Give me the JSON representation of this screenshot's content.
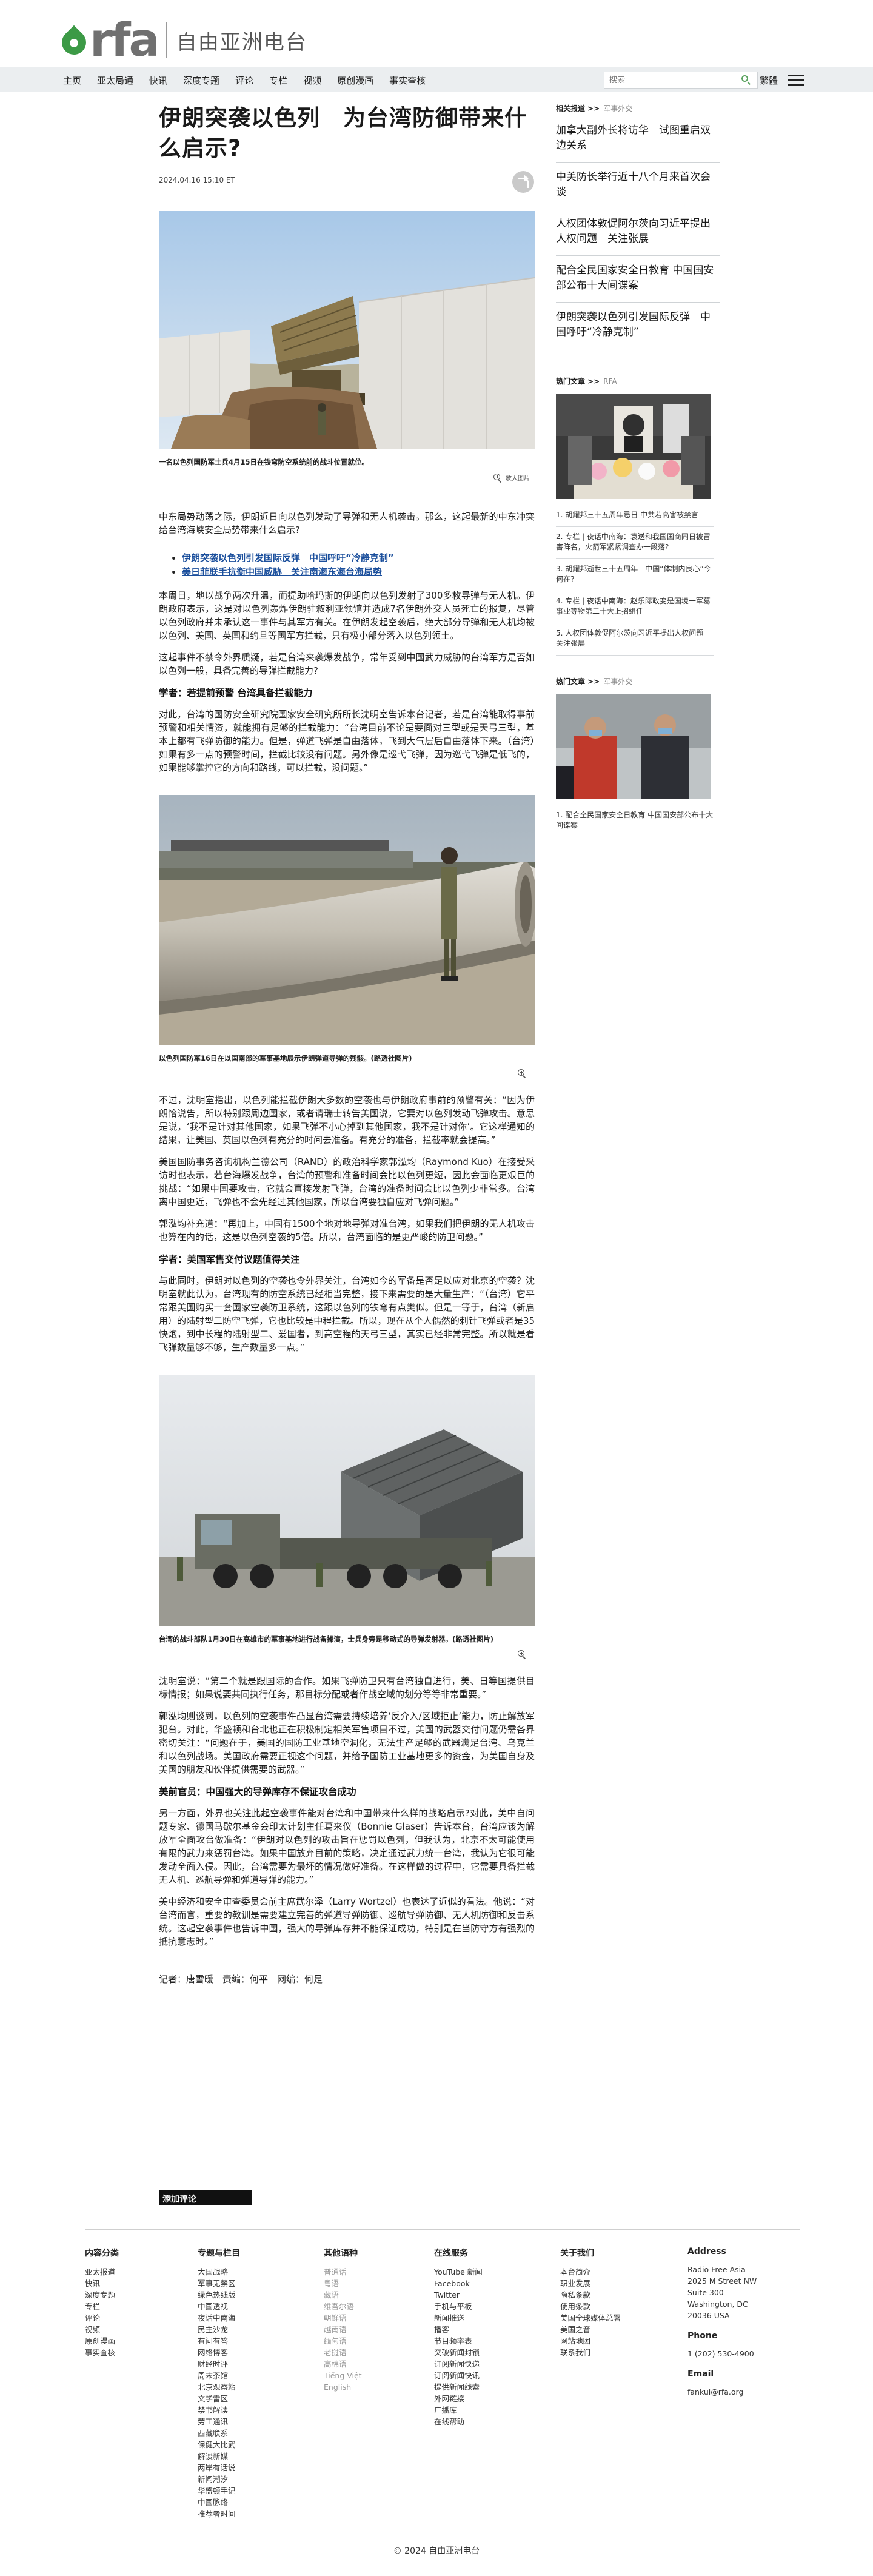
{
  "header": {
    "logo_text": "rfa",
    "logo_cn": "自由亚洲电台"
  },
  "nav": {
    "items": [
      "主页",
      "亚太局通",
      "快讯",
      "深度专题",
      "评论",
      "专栏",
      "视频",
      "原创漫画",
      "事实查核"
    ],
    "search_placeholder": "搜索",
    "lang": "繁體"
  },
  "article": {
    "title": "伊朗突袭以色列　为台湾防御带来什么启示?",
    "date": "2024.04.16 15:10 ET",
    "fig1_caption": "一名以色列国防军士兵4月15日在铁穹防空系统前的战斗位置就位。",
    "zoom_label": "放大图片",
    "p1": "中东局势动荡之际，伊朗近日向以色列发动了导弹和无人机袭击。那么，这起最新的中东冲突给台湾海峡安全局势带来什么启示?",
    "links": [
      "伊朗突袭以色列引发国际反弹　中国呼吁“冷静克制”",
      "美日菲联手抗衡中国威胁　关注南海东海台海局势"
    ],
    "p2": "本周日，地以战争两次升温，而提助哈玛斯的伊朗向以色列发射了300多枚导弹与无人机。伊朗政府表示，这是对以色列轰炸伊朗驻叙利亚领馆并造成7名伊朗外交人员死亡的报复，尽管以色列政府并未承认这一事件与其军方有关。在伊朗发起空袭后，绝大部分导弹和无人机均被以色列、美国、英国和约旦等国军方拦截，只有极小部分落入以色列领土。",
    "p3": "这起事件不禁令外界质疑，若是台湾来袭爆发战争，常年受到中国武力威胁的台湾军方是否如以色列一般，具备完善的导弹拦截能力?",
    "sub1": "学者：若提前预警 台湾具备拦截能力",
    "p4": "对此，台湾的国防安全研究院国家安全研究所所长沈明室告诉本台记者，若是台湾能取得事前预警和相关情资，就能拥有足够的拦截能力：“台湾目前不论是要面对三型或是天弓三型，基本上都有飞弹防御的能力。但是，弹道飞弹是自由落体，飞到大气层后自由落体下来。（台湾）如果有多一点的预警时间，拦截比较没有问题。另外像是巡弋飞弹，因为巡弋飞弹是低飞的，如果能够掌控它的方向和路线，可以拦截，没问题。”",
    "fig2_caption": "以色列国防军16日在以国南部的军事基地展示伊朗弹道导弹的残骸。(路透社图片)",
    "p5": "不过，沈明室指出，以色列能拦截伊朗大多数的空袭也与伊朗政府事前的预警有关：“因为伊朗恰说告，所以特别跟周边国家，或者请瑞士转告美国说，它要对以色列发动飞弹攻击。意思是说，‘我不是针对其他国家，如果飞弹不小心掉到其他国家，我不是针对你’。它这样通知的结果，让美国、英国以色列有充分的时间去准备。有充分的准备，拦截率就会提高。”",
    "p6": "美国国防事务咨询机构兰德公司（RAND）的政治科学家郭泓均（Raymond Kuo）在接受采访时也表示，若台海爆发战争，台湾的预警和准备时间会比以色列更短，因此会面临更艰巨的挑战：“如果中国要攻击，它就会直接发射飞弹，台湾的准备时间会比以色列少非常多。台湾离中国更近，飞弹也不会先经过其他国家，所以台湾要独自应对飞弹问题。”",
    "p7": "郭泓均补充道：“再加上，中国有1500个地对地导弹对准台湾，如果我们把伊朗的无人机攻击也算在内的话，这是以色列空袭的5倍。所以，台湾面临的是更严峻的防卫问题。”",
    "sub2": "学者：美国军售交付议题值得关注",
    "p8": "与此同时，伊朗对以色列的空袭也令外界关注，台湾如今的军备是否足以应对北京的空袭？沈明室就此认为，台湾现有的防空系统已经相当完整，接下来需要的是大量生产：“（台湾）它平常跟美国购买一套国家空袭防卫系统，这跟以色列的铁穹有点类似。但是一等于，台湾（新启用）的陆射型二防空飞弹，它也比较是中程拦截。所以，现在从个人偶然的刺针飞弹或者是35快炮，到中长程的陆射型二、爱国者，到高空程的天弓三型，其实已经非常完整。所以就是看飞弹数量够不够，生产数量多一点。”",
    "fig3_caption": "台湾的战斗部队1月30日在高雄市的军事基地进行战备操演，士兵身旁是移动式的导弹发射器。(路透社图片)",
    "p9": "沈明室说：“第二个就是跟国际的合作。如果飞弹防卫只有台湾独自进行，美、日等国提供目标情报；如果说要共同执行任务，那目标分配或者作战空域的划分等等非常重要。”",
    "p10": "郭泓均则谈到，以色列的空袭事件凸显台湾需要持续培养‘反介入/区域拒止’能力，防止解放军犯台。对此，华盛顿和台北也正在积极制定相关军售项目不过，美国的武器交付问题仍需各界密切关注：“问题在于，美国的国防工业基地空洞化，无法生产足够的武器满足台湾、乌克兰和以色列战场。美国政府需要正视这个问题，并给予国防工业基地更多的资金，为美国自身及美国的朋友和伙伴提供需要的武器。”",
    "sub3": "美前官员：中国强大的导弹库存不保证攻台成功",
    "p11": "另一方面，外界也关注此起空袭事件能对台湾和中国带来什么样的战略启示?对此，美中自问题专家、德国马歇尔基金会印太计划主任葛来仪（Bonnie Glaser）告诉本台，台湾应该为解放军全面攻台做准备：“伊朗对以色列的攻击旨在惩罚以色列，但我认为，北京不太可能使用有限的武力来惩罚台湾。如果中国放弃目前的策略，决定通过武力统一台湾，我认为它很可能发动全面入侵。因此，台湾需要为最坏的情况做好准备。在这样做的过程中，它需要具备拦截无人机、巡航导弹和弹道导弹的能力。”",
    "p12": "美中经济和安全审查委员会前主席武尔泽（Larry Wortzel）也表达了近似的看法。他说：“对台湾而言，重要的教训是需要建立完善的弹道导弹防御、巡航导弹防御、无人机防御和反击系统。这起空袭事件也告诉中国，强大的导弹库存并不能保证成功，特别是在当防守方有强烈的抵抗意志时。”",
    "credits": "记者：唐雪暖　责编：何平　网编：何足"
  },
  "sidebar": {
    "related_head": "相关报道 >>",
    "related_tag": "军事外交",
    "related": [
      "加拿大副外长将访华　试图重启双边关系",
      "中美防长举行近十八个月来首次会谈",
      "人权团体敦促阿尔茨向习近平提出人权问题　关注张展",
      "配合全民国家安全日教育 中国国安部公布十大间谍案",
      "伊朗突袭以色列引发国际反弹　中国呼吁“冷静克制”"
    ],
    "hot1_head": "热门文章 >>",
    "hot1_tag": "RFA",
    "hot1": [
      "1. 胡耀邦三十五周年忌日 中共若高害被禁言",
      "2. 专栏 | 夜话中南海：袁送和我国国商同日被冒害阵名，火箭军紧紧调查办一段落?",
      "3. 胡耀邦逝世三十五周年　中国“体制内良心”今何在?",
      "4. 专栏 | 夜话中南海：赵乐际政变是国境一军葛事业等物第二十大上招组任",
      "5. 人权团体敦促阿尔茨向习近平提出人权问题　关注张展"
    ],
    "hot2_head": "热门文章 >>",
    "hot2_tag": "军事外交",
    "hot2": [
      "1. 配合全民国家安全日教育 中国国安部公布十大间谍案"
    ]
  },
  "comment_bar": "添加评论",
  "footer": {
    "col1": {
      "title": "内容分类",
      "items": [
        "亚太报道",
        "快讯",
        "深度专题",
        "专栏",
        "评论",
        "视频",
        "原创漫画",
        "事实查核"
      ]
    },
    "col2": {
      "title": "专题与栏目",
      "items": [
        "大国战略",
        "军事无禁区",
        "绿色热线版",
        "中国透视",
        "夜话中南海",
        "民主沙龙",
        "有问有答",
        "网络博客",
        "财经时评",
        "周末茶馆",
        "北京观察站",
        "文学雷区",
        "禁书解读",
        "劳工通讯",
        "西藏联系",
        "保健大比武",
        "解谈新媒",
        "两岸有话说",
        "新闻潮汐",
        "华盛顿手记",
        "中国脉络",
        "推荐者时间"
      ]
    },
    "col3": {
      "title": "其他语种",
      "items": [
        "普通话",
        "粤语",
        "藏语",
        "维吾尔语",
        "朝鲜语",
        "越南语",
        "缅甸语",
        "老挝语",
        "高棉语",
        "Tiếng Việt",
        "English"
      ]
    },
    "col4": {
      "title": "在线服务",
      "items": [
        "YouTube 新闻",
        "Facebook",
        "Twitter",
        "手机与平板",
        "新闻推送",
        "播客",
        "节目频率表",
        "突破新闻封锁",
        "订阅新闻快递",
        "订阅新闻快讯",
        "提供新闻线索",
        "外网链接",
        "广播库",
        "在线帮助"
      ]
    },
    "col5": {
      "title": "关于我们",
      "items": [
        "本台简介",
        "职业发展",
        "隐私条款",
        "使用条款",
        "美国全球媒体总署",
        "美国之音",
        "网站地图",
        "联系我们"
      ]
    },
    "col6": {
      "title": "Address",
      "items": [
        "Radio Free Asia",
        "2025 M Street NW",
        "Suite 300",
        "Washington, DC",
        "20036 USA"
      ],
      "phone_title": "Phone",
      "phone": "1 (202) 530-4900",
      "email_title": "Email",
      "email": "fankui@rfa.org"
    }
  },
  "copyright": "© 2024 自由亚洲电台",
  "colors": {
    "accent_green": "#3c9a46",
    "link_blue": "#1b4f9c",
    "nav_bg": "#ebeef0"
  }
}
